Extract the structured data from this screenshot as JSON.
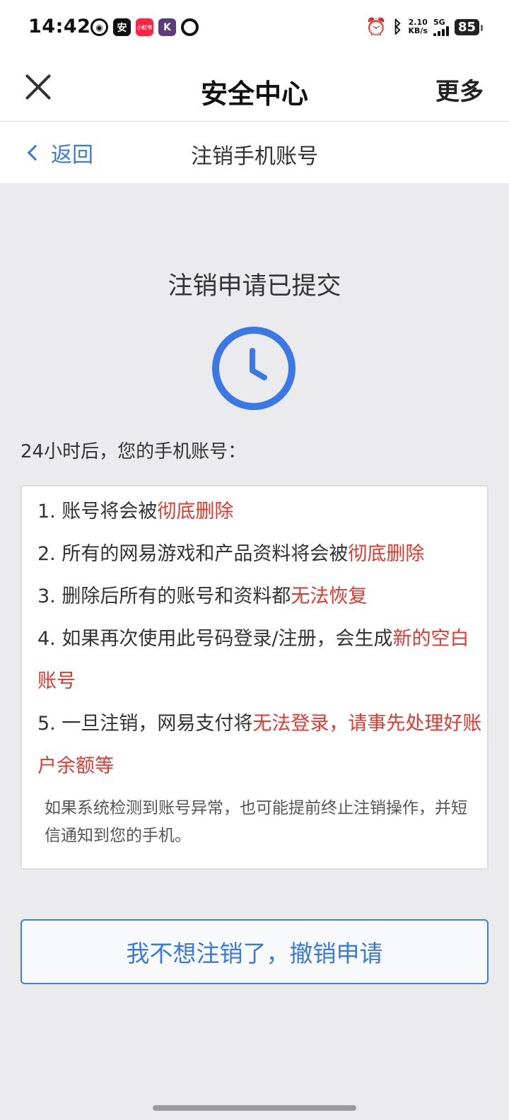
{
  "status_bar": {
    "time": "14:42",
    "app_labels": [
      "安",
      "小红书",
      "K"
    ],
    "net_speed_value": "2.10",
    "net_speed_unit": "KB/s",
    "network": "5G",
    "battery": "85"
  },
  "header": {
    "title": "安全中心",
    "more_label": "更多"
  },
  "sub_header": {
    "back_label": "返回",
    "title": "注销手机账号"
  },
  "main": {
    "status_heading": "注销申请已提交",
    "intro": "24小时后，您的手机账号：",
    "items": [
      {
        "normal": "1. 账号将会被",
        "highlight": "彻底删除"
      },
      {
        "normal": "2. 所有的网易游戏和产品资料将会被",
        "highlight": "彻底删除"
      },
      {
        "normal": "3. 删除后所有的账号和资料都",
        "highlight": "无法恢复"
      },
      {
        "normal": "4. 如果再次使用此号码登录/注册，会生成",
        "highlight": "新的空白账号"
      },
      {
        "normal": "5. 一旦注销，网易支付将",
        "highlight": "无法登录，请事先处理好账户余额等"
      }
    ],
    "note": "如果系统检测到账号异常，也可能提前终止注销操作，并短信通知到您的手机。",
    "cancel_button_label": "我不想注销了，撤销申请"
  },
  "colors": {
    "accent_blue": "#3a7ad9",
    "highlight_red": "#e03a2e",
    "clock_blue": "#3a78e6"
  },
  "icons": [
    "close-icon",
    "chevron-left-icon",
    "clock-icon"
  ]
}
